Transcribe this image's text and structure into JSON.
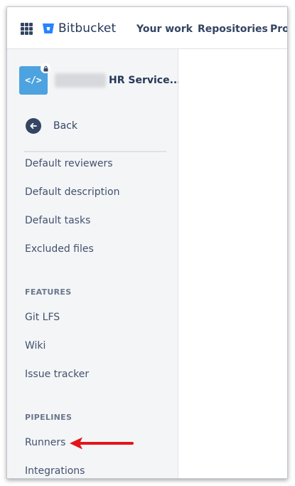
{
  "app": {
    "name": "Bitbucket"
  },
  "topnav": {
    "items": [
      "Your work",
      "Repositories",
      "Proj"
    ]
  },
  "repo": {
    "name": "HR Service..."
  },
  "sidebar": {
    "back_label": "Back",
    "items_top": [
      "Default reviewers",
      "Default description",
      "Default tasks",
      "Excluded files"
    ],
    "features_heading": "FEATURES",
    "features_items": [
      "Git LFS",
      "Wiki",
      "Issue tracker"
    ],
    "pipelines_heading": "PIPELINES",
    "pipelines_items": [
      "Runners",
      "Integrations"
    ]
  },
  "colors": {
    "brand": "#2684ff",
    "annotation_arrow": "#e3151a",
    "sidebar_bg": "#f4f5f7",
    "repo_avatar": "#4da3df"
  },
  "icons": [
    "app-switcher-icon",
    "bitbucket-logo-icon",
    "code-icon",
    "lock-icon",
    "back-arrow-icon"
  ]
}
